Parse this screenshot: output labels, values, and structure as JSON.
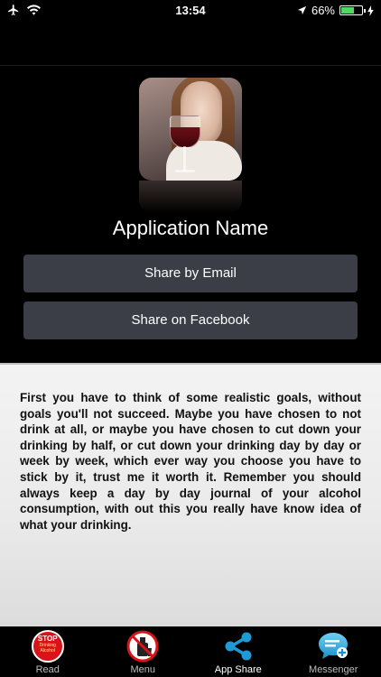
{
  "status_bar": {
    "time": "13:54",
    "battery_percent_label": "66%",
    "battery_level": 0.66,
    "icons": [
      "airplane-icon",
      "wifi-icon",
      "location-arrow-icon",
      "battery-icon",
      "charging-bolt-icon"
    ]
  },
  "header": {
    "app_icon": "woman-with-wine-glass",
    "app_name": "Application Name"
  },
  "share": {
    "email_label": "Share by Email",
    "facebook_label": "Share on Facebook"
  },
  "content": {
    "body": "First you have to think of some realistic goals, without goals you'll not succeed. Maybe you have chosen to not drink at all, or maybe you have chosen to cut down your drinking by half, or cut down your drinking day by day or week by week, which ever way you choose you have to stick by it, trust me it worth it. Remember you should always keep a day by day journal of your alcohol consumption, with out this you really have know idea of what your drinking."
  },
  "tab_bar": {
    "tabs": [
      {
        "label": "Read",
        "icon": "stop-drinking-alcohol-icon",
        "icon_text_top": "STOP",
        "icon_text_bottom": "Drinking Alcohol",
        "active": false
      },
      {
        "label": "Menu",
        "icon": "no-alcohol-icon",
        "active": false
      },
      {
        "label": "App Share",
        "icon": "share-icon",
        "active": true
      },
      {
        "label": "Messenger",
        "icon": "messenger-icon",
        "active": false
      }
    ]
  },
  "colors": {
    "background": "#000000",
    "button": "#3b3e47",
    "panel": "#eaeaea",
    "accent_blue": "#1e9bd7",
    "stop_red": "#d8141a",
    "battery_green": "#4cd964"
  }
}
